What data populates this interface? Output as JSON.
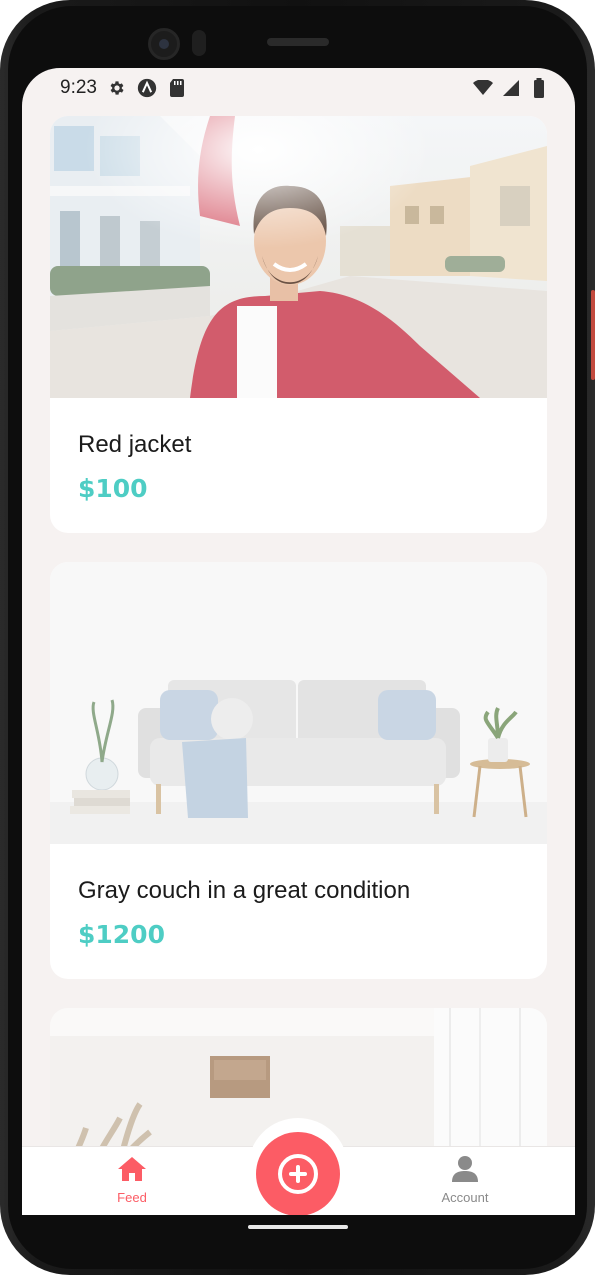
{
  "status_bar": {
    "time": "9:23",
    "left_icons": [
      "gear-icon",
      "a-badge-icon",
      "sd-card-icon"
    ],
    "right_icons": [
      "wifi-icon",
      "signal-icon",
      "battery-icon"
    ]
  },
  "listings": [
    {
      "title": "Red jacket",
      "price": "$100",
      "image": "man-in-red-jacket-photo"
    },
    {
      "title": "Gray couch in a great condition",
      "price": "$1200",
      "image": "gray-couch-living-room-photo"
    },
    {
      "title": "",
      "price": "",
      "image": "room-with-painting-photo"
    }
  ],
  "bottom_nav": {
    "feed_label": "Feed",
    "account_label": "Account",
    "add_button": "add-listing-button"
  },
  "colors": {
    "accent": "#fc5c65",
    "price": "#4ecdc4",
    "background": "#f6f2f1",
    "inactive": "#8a8a8a"
  }
}
